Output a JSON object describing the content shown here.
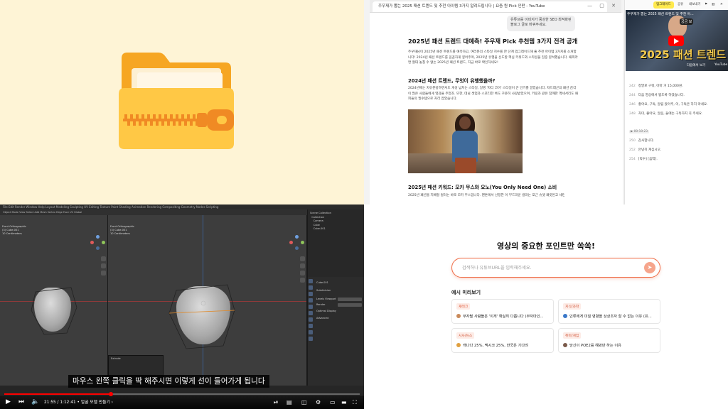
{
  "colors": {
    "q1_bg": "#fef4d6",
    "folder_back": "#f6a623",
    "folder_front": "#ffc845",
    "zipper": "#f08a24",
    "accent_orange": "#ef6d47",
    "upgrade_yellow": "#ffe94d",
    "yt_red": "#ff0000"
  },
  "q1": {
    "icon": "zip-folder-icon"
  },
  "q2": {
    "tab_title": "주우재가 뽑는 2025 패션 트렌드 및 추천 아이템 3가지 알려드립니다 | 요즘 뭔 Pick 인펀 - YouTube",
    "chat_bubble": "유튜브를 이미지가 풍성한 SEO 최적화된 블로그 글로 바꿔주세요.",
    "title": "2025년 패션 트렌드 대예측! 주우재 Pick 추천템 3가지 전격 공개",
    "intro": "주우재님이 2025년 패션 트렌드를 예측하고, 여러분의 스타일 지수를 한 단계 업그레이드해 줄 추천 아이템 3가지를 소개합니다! 2024년 패션 트렌드를 꼼꼼하게 짚어주며, 2025년 유행을 선도할 핵심 키워드와 스타일을 집중 분석했습니다. 패피라면 절대 놓칠 수 없는 2025년 패션 트렌드, 지금 바로 확인하세요!",
    "h2_2024": "2024년 패션 트렌드, 무엇이 유행했을까?",
    "para_2024": "2024년에는 자유분방하면서도 개성 넘치는 스타일, 일명 '자디 코어' 스타일이 큰 인기를 끌었습니다. 자드레곤의 패션 감각이 많은 사람들에게 영감을 주었죠. 또한, 데님 셋업과 스포티한 룩도 꾸준히 사랑받았으며, 키링과 같은 참깨한 액세서리도 패피들의 필수템으로 자리 잡았습니다.",
    "h2_2025": "2025년 패션 키워드: 모카 무스와 요노(You Only Need One) 소비",
    "para_2025": "2025년 패션을 지배할 컬러는 바로 모카 무스입니다. 팬톤에서 선정한 이 부드러운 컬러는 포근 슈엣 패킷된고 세련",
    "side": {
      "upgrade": "업그레이드",
      "share": "공유",
      "export": "내보내기",
      "yt_title": "주우재가 뽑는 2025 패션 트렌드 및 추천 아...",
      "yt_bubble": "궁금 보",
      "yt_big": "2025 패션 트렌드",
      "yt_more": "다음에서 보기",
      "yt_logo": "YouTube",
      "tag": "▶ 00:10:23",
      "lines_a": [
        {
          "t": "242",
          "s": "정말로 구워, 아마 거 15,000원."
        },
        {
          "t": "244",
          "s": "다음 영상에서 뵙도록 하겠습니다."
        },
        {
          "t": "246",
          "s": "좋아요, 구독, 알림 앉아주, 이, 구독은 하지 마세요."
        },
        {
          "t": "248",
          "s": "차미, 좋아요, 알음, 들에는 구독하지 꼭 주세요."
        }
      ],
      "lines_b": [
        {
          "t": "250",
          "s": "감사합니다."
        },
        {
          "t": "252",
          "s": "안녕히 계십시오."
        },
        {
          "t": "254",
          "s": "[박수] [음악]."
        }
      ]
    }
  },
  "q3": {
    "menu": "File  Edit  Render  Window  Help     Layout  Modeling  Sculpting  UV Editing  Texture Paint  Shading  Animation  Rendering  Compositing  Geometry Nodes  Scripting",
    "header": "Object Mode   View  Select  Add  Mesh  Vertex  Edge  Face  UV           Global",
    "vp1_info": "Front Orthographic\n(3) Cube.001\n10 Centimeters",
    "vp2_info": "Front Orthographic\n(3) Cube.001\n10 Centimeters",
    "outliner": "Scene Collection\n  Collection\n    Camera\n    Cube\n    Cube.001",
    "props_rows": [
      "Cube.001",
      "Subdivision",
      "Levels Viewport",
      "Render",
      "Optimal Display",
      "Advanced"
    ],
    "redo_title": "Extrude",
    "subtitle": "마우스 왼쪽 클릭을 딱 해주시면 이렇게 선이 들어가게 됩니다",
    "time": "21:55 / 1:12:41 • 얼굴 모델 만들기 ›",
    "progress": 0.3
  },
  "q4": {
    "title": "영상의 중요한 포인트만 쏙쏙!",
    "search_placeholder": "검색하나 유튜브URL을 입력해주세요.",
    "go": "➤",
    "examples_label": "예시 미리보기",
    "cards": [
      {
        "tag": "재테크",
        "tag_color": "#e05a3a",
        "tag_bg": "#fdece7",
        "text": "부자될 사람들은 '이게' 확실히 다릅니다 (부자마인...",
        "av": "#c98a5a"
      },
      {
        "tag": "지식/과학",
        "tag_color": "#d0573a",
        "tag_bg": "#fdece7",
        "text": "인류에게 미칠 영향을 상상초자 할 수 없는 이유 (유...",
        "av": "#3a78c9"
      },
      {
        "tag": "시사/뉴스",
        "tag_color": "#d0573a",
        "tag_bg": "#fdece7",
        "text": "캐나다 25%, 멕시코 25%, 한국은 기다려",
        "av": "#e0a040"
      },
      {
        "tag": "취미/게임",
        "tag_color": "#d0573a",
        "tag_bg": "#fdece7",
        "text": "당신이 POE2를 해봐만 하는 이유",
        "av": "#7a5a4a"
      }
    ]
  }
}
